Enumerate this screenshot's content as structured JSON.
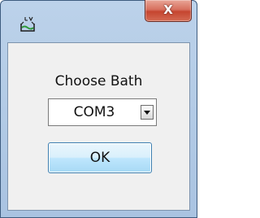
{
  "window": {
    "title": "",
    "icon": "bath-app-icon",
    "close_button": {
      "glyph": "X",
      "icon": "close-icon"
    }
  },
  "dialog": {
    "prompt": "Choose Bath",
    "port_select": {
      "selected_value": "COM3",
      "dropdown_icon": "chevron-down-icon"
    },
    "ok_label": "OK"
  },
  "colors": {
    "titlebar": "#bcd2ea",
    "close_button": "#c5452f",
    "client_background": "#f0f0f0",
    "ok_button_border": "#3c7fb1"
  }
}
